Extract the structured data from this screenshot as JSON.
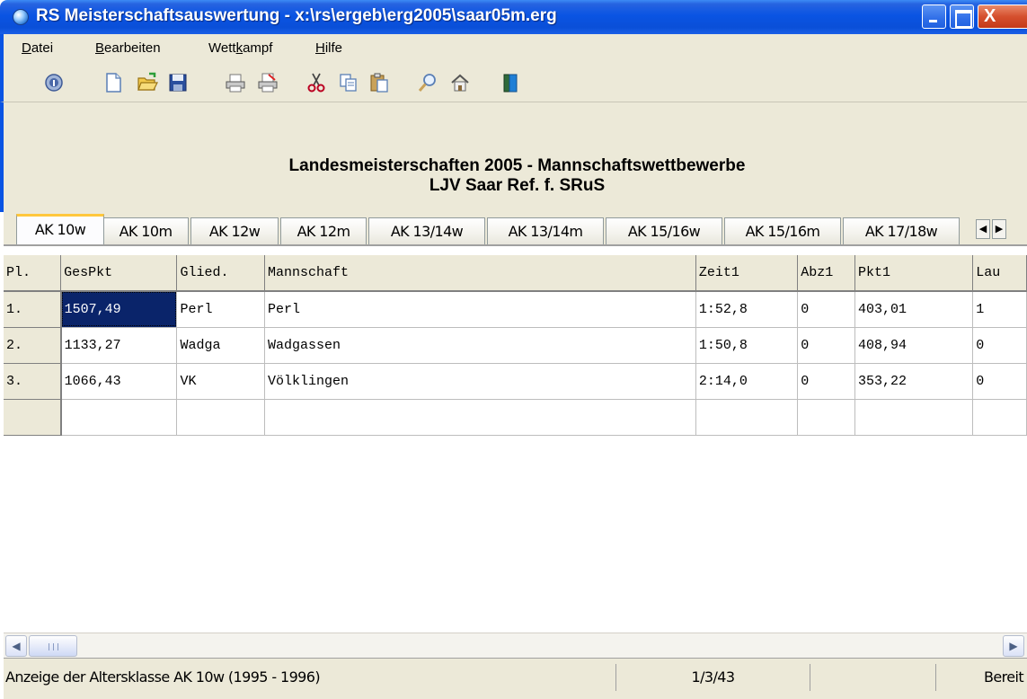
{
  "window": {
    "title": "RS Meisterschaftsauswertung - x:\\rs\\ergeb\\erg2005\\saar05m.erg",
    "close_glyph": "X"
  },
  "menu": [
    {
      "label": "Datei",
      "accel": "D"
    },
    {
      "label": "Bearbeiten",
      "accel": "B"
    },
    {
      "label": "Wettkampf",
      "accel": "k"
    },
    {
      "label": "Hilfe",
      "accel": "H"
    }
  ],
  "toolbar": {
    "icons": [
      "info-icon",
      "new-document-icon",
      "open-folder-icon",
      "save-disk-icon",
      "print-icon",
      "print-preview-icon",
      "cut-scissors-icon",
      "copy-icon",
      "paste-icon",
      "find-magnifier-icon",
      "home-icon",
      "exit-door-icon"
    ]
  },
  "heading": {
    "line1": "Landesmeisterschaften 2005 - Mannschaftswettbewerbe",
    "line2": "LJV Saar Ref. f. SRuS"
  },
  "tabs": [
    "AK 10w",
    "AK 10m",
    "AK 12w",
    "AK 12m",
    "AK 13/14w",
    "AK 13/14m",
    "AK 15/16w",
    "AK 15/16m",
    "AK 17/18w"
  ],
  "active_tab": "AK 10w",
  "tab_scroll": {
    "left": "◀",
    "right": "▶"
  },
  "grid": {
    "columns": [
      "Pl.",
      "GesPkt",
      "Glied.",
      "Mannschaft",
      "Zeit1",
      "Abz1",
      "Pkt1",
      "Lau"
    ],
    "rows": [
      [
        "1.",
        "1507,49",
        "Perl",
        "Perl",
        "1:52,8",
        "0",
        "403,01",
        "1"
      ],
      [
        "2.",
        "1133,27",
        "Wadga",
        "Wadgassen",
        "1:50,8",
        "0",
        "408,94",
        "0"
      ],
      [
        "3.",
        "1066,43",
        "VK",
        "Völklingen",
        "2:14,0",
        "0",
        "353,22",
        "0"
      ],
      [
        "",
        "",
        "",
        "",
        "",
        "",
        "",
        ""
      ]
    ]
  },
  "scrollbar": {
    "left": "◀",
    "right": "▶"
  },
  "status": {
    "message": "Anzeige der Altersklasse AK 10w (1995 - 1996)",
    "position": "1/3/43",
    "extra": "",
    "state": "Bereit"
  },
  "colors": {
    "titlebar": "#0a54e3",
    "chrome": "#ece9d8",
    "selection": "#0a246a",
    "active_tab_accent": "#ffc73c"
  }
}
